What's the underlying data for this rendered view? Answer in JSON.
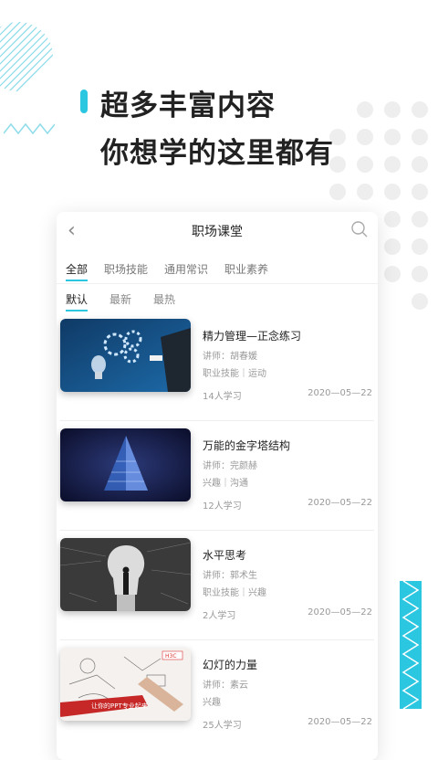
{
  "hero": {
    "line1": "超多丰富内容",
    "line2": "你想学的这里都有"
  },
  "nav": {
    "title": "职场课堂"
  },
  "categories": [
    "全部",
    "职场技能",
    "通用常识",
    "职业素养"
  ],
  "sorts": [
    "默认",
    "最新",
    "最热"
  ],
  "courses": [
    {
      "title": "精力管理—正念练习",
      "lecturer": "讲师：胡春媛",
      "tags": "职业技能｜运动",
      "learners": "14人学习",
      "date": "2020—05—22",
      "thumb": "gears-lightbulb"
    },
    {
      "title": "万能的金字塔结构",
      "lecturer": "讲师：完颜赫",
      "tags": "兴趣｜沟通",
      "learners": "12人学习",
      "date": "2020—05—22",
      "thumb": "pyramid"
    },
    {
      "title": "水平思考",
      "lecturer": "讲师：郭术生",
      "tags": "职业技能｜兴趣",
      "learners": "2人学习",
      "date": "2020—05—22",
      "thumb": "lightbulb-silhouette"
    },
    {
      "title": "幻灯的力量",
      "lecturer": "讲师：素云",
      "tags": "兴趣",
      "learners": "25人学习",
      "date": "2020—05—22",
      "thumb": "ppt-notes",
      "thumb_text": "让你的PPT专业起来"
    }
  ],
  "colors": {
    "accent": "#2bc7e0",
    "bar": "#2bc7e0"
  }
}
